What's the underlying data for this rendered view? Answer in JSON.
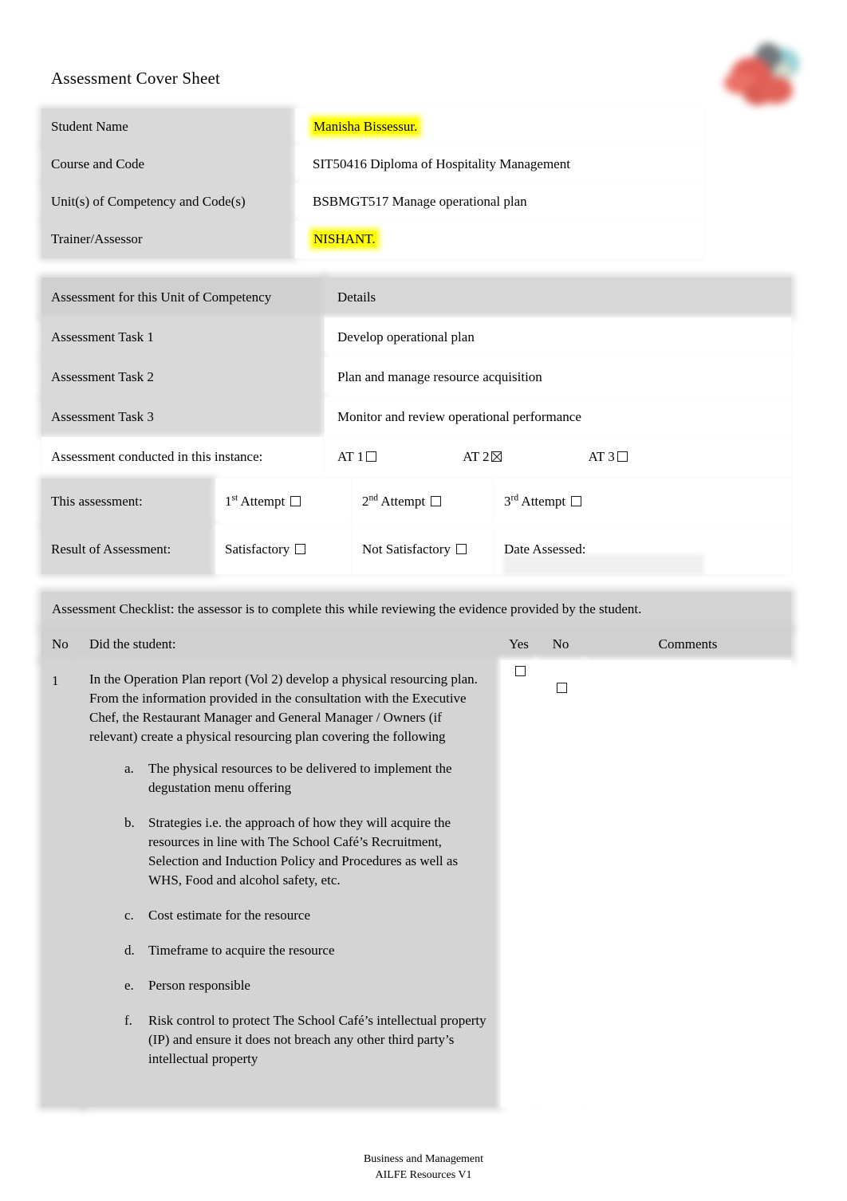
{
  "document": {
    "title": "Assessment Cover Sheet",
    "logo_name": "organisation-logo"
  },
  "student_table": {
    "rows": [
      {
        "label": "Student Name",
        "value": "Manisha Bissessur.",
        "highlight": true
      },
      {
        "label": "Course and Code",
        "value": "SIT50416 Diploma of Hospitality Management",
        "highlight": false
      },
      {
        "label": "Unit(s) of Competency and Code(s)",
        "value": "BSBMGT517 Manage operational plan",
        "highlight": false
      },
      {
        "label": "Trainer/Assessor",
        "value": "NISHANT.",
        "highlight": true
      }
    ]
  },
  "tasks_table": {
    "header": {
      "left": "Assessment for this Unit of Competency",
      "right": "Details"
    },
    "rows": [
      {
        "label": "Assessment Task 1",
        "detail": "Develop operational plan"
      },
      {
        "label": "Assessment Task 2",
        "detail": "Plan and manage resource acquisition"
      },
      {
        "label": "Assessment Task 3",
        "detail": "Monitor and review operational performance"
      }
    ],
    "conducted": {
      "label": "Assessment conducted in this instance:",
      "options": [
        {
          "label": "AT 1",
          "checked": false
        },
        {
          "label": "AT 2",
          "checked": true
        },
        {
          "label": "AT 3",
          "checked": false
        }
      ]
    }
  },
  "result_table": {
    "attempt_row": {
      "label": "This assessment:",
      "options": [
        {
          "ordinal": "1",
          "suffix": "st",
          "label": " Attempt ",
          "checked": false
        },
        {
          "ordinal": "2",
          "suffix": "nd",
          "label": " Attempt ",
          "checked": false
        },
        {
          "ordinal": "3",
          "suffix": "rd",
          "label": " Attempt ",
          "checked": false
        }
      ]
    },
    "result_row": {
      "label": "Result of Assessment:",
      "options": [
        {
          "label": "Satisfactory ",
          "checked": false
        },
        {
          "label": "Not Satisfactory ",
          "checked": false
        }
      ],
      "date_label": "Date Assessed:",
      "date_value": ""
    }
  },
  "checklist": {
    "banner": "Assessment Checklist: the assessor is to complete this while reviewing the evidence provided by the student.",
    "headers": {
      "no": "No",
      "did": "Did the student:",
      "yes": "Yes",
      "no2": "No",
      "comments": "Comments"
    },
    "rows": [
      {
        "no": "1",
        "text": "In the Operation Plan report (Vol 2) develop a physical resourcing plan. From the information provided in the consultation with the Executive Chef, the Restaurant Manager and General Manager / Owners (if relevant) create a physical resourcing plan covering the following",
        "subitems": [
          {
            "marker": "a.",
            "text": "The physical resources to be delivered to implement the degustation menu offering"
          },
          {
            "marker": "b.",
            "text": "Strategies i.e. the approach of how they will acquire the resources in line with The School Café’s Recruitment, Selection and Induction Policy and Procedures as well as WHS, Food and alcohol safety, etc."
          },
          {
            "marker": "c.",
            "text": "Cost estimate for the resource"
          },
          {
            "marker": "d.",
            "text": "Timeframe to acquire the resource"
          },
          {
            "marker": "e.",
            "text": "Person responsible"
          },
          {
            "marker": "f.",
            "text": "Risk control to protect The School Café’s intellectual property (IP) and ensure it does not breach any other third party’s intellectual property"
          }
        ],
        "yes_checked": false,
        "no_checked": false,
        "comments": ""
      }
    ]
  },
  "footer": {
    "line1": "Business and Management",
    "line2": "AILFE Resources V1"
  },
  "colors": {
    "highlight": "#ffff00",
    "cell_grey": "#d9d9d9",
    "header_grey": "#d0d0d0",
    "text": "#000000"
  }
}
